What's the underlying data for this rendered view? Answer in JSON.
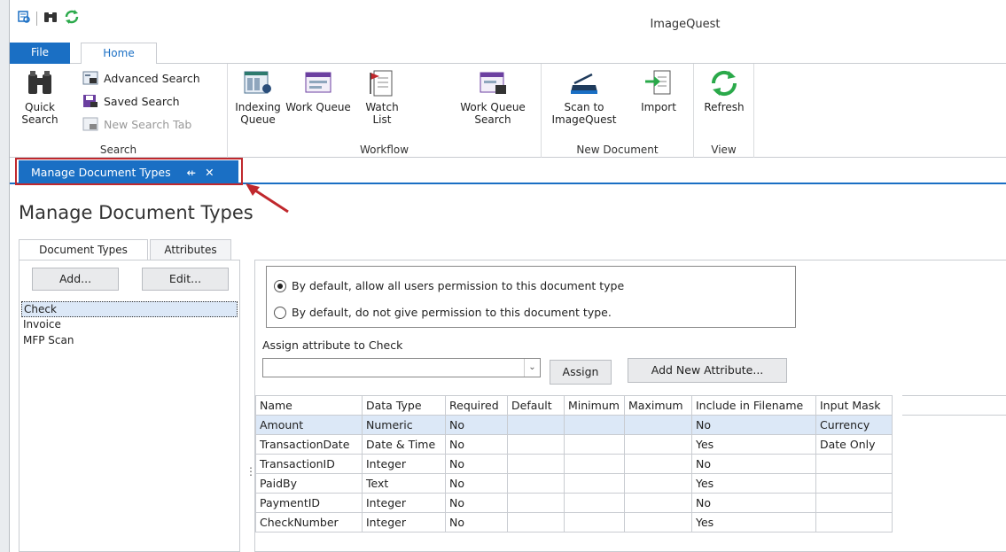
{
  "app": {
    "title": "ImageQuest"
  },
  "quick_access": {
    "icons": [
      "document-search-icon",
      "binoculars-icon",
      "refresh-icon"
    ]
  },
  "ribbon_tabs": {
    "file": "File",
    "home": "Home"
  },
  "ribbon": {
    "search_group": {
      "label": "Search",
      "quick_search": "Quick\nSearch",
      "quick_search_l1": "Quick",
      "quick_search_l2": "Search",
      "advanced_search": "Advanced Search",
      "saved_search": "Saved Search",
      "new_search_tab": "New Search Tab"
    },
    "workflow_group": {
      "label": "Workflow",
      "indexing_queue_l1": "Indexing",
      "indexing_queue_l2": "Queue",
      "work_queue": "Work Queue",
      "watch_list_l1": "Watch",
      "watch_list_l2": "List",
      "work_queue_search_l1": "Work Queue",
      "work_queue_search_l2": "Search"
    },
    "new_document_group": {
      "label": "New Document",
      "scan_l1": "Scan to",
      "scan_l2": "ImageQuest",
      "import": "Import"
    },
    "view_group": {
      "label": "View",
      "refresh": "Refresh"
    }
  },
  "doc_tab": {
    "label": "Manage Document Types",
    "pin": "⇷",
    "close": "✕"
  },
  "page": {
    "title": "Manage Document Types"
  },
  "subtabs": {
    "document_types": "Document Types",
    "attributes": "Attributes"
  },
  "left": {
    "add": "Add...",
    "edit": "Edit...",
    "items": [
      "Check",
      "Invoice",
      "MFP Scan"
    ]
  },
  "permissions": {
    "allow": "By default, allow all users permission to this document type",
    "deny": "By default, do not give permission to this document type."
  },
  "assign": {
    "label": "Assign attribute to Check",
    "combo_value": "",
    "assign_button": "Assign",
    "add_new_button": "Add New Attribute..."
  },
  "grid": {
    "columns": [
      "Name",
      "Data Type",
      "Required",
      "Default",
      "Minimum",
      "Maximum",
      "Include in Filename",
      "Input Mask"
    ],
    "rows": [
      [
        "Amount",
        "Numeric",
        "No",
        "",
        "",
        "",
        "No",
        "Currency"
      ],
      [
        "TransactionDate",
        "Date & Time",
        "No",
        "",
        "",
        "",
        "Yes",
        "Date Only"
      ],
      [
        "TransactionID",
        "Integer",
        "No",
        "",
        "",
        "",
        "No",
        ""
      ],
      [
        "PaidBy",
        "Text",
        "No",
        "",
        "",
        "",
        "Yes",
        ""
      ],
      [
        "PaymentID",
        "Integer",
        "No",
        "",
        "",
        "",
        "No",
        ""
      ],
      [
        "CheckNumber",
        "Integer",
        "No",
        "",
        "",
        "",
        "Yes",
        ""
      ]
    ]
  },
  "colors": {
    "accent": "#1a6fc4",
    "highlight_border": "#c0282d",
    "selection": "#dce8f7"
  }
}
